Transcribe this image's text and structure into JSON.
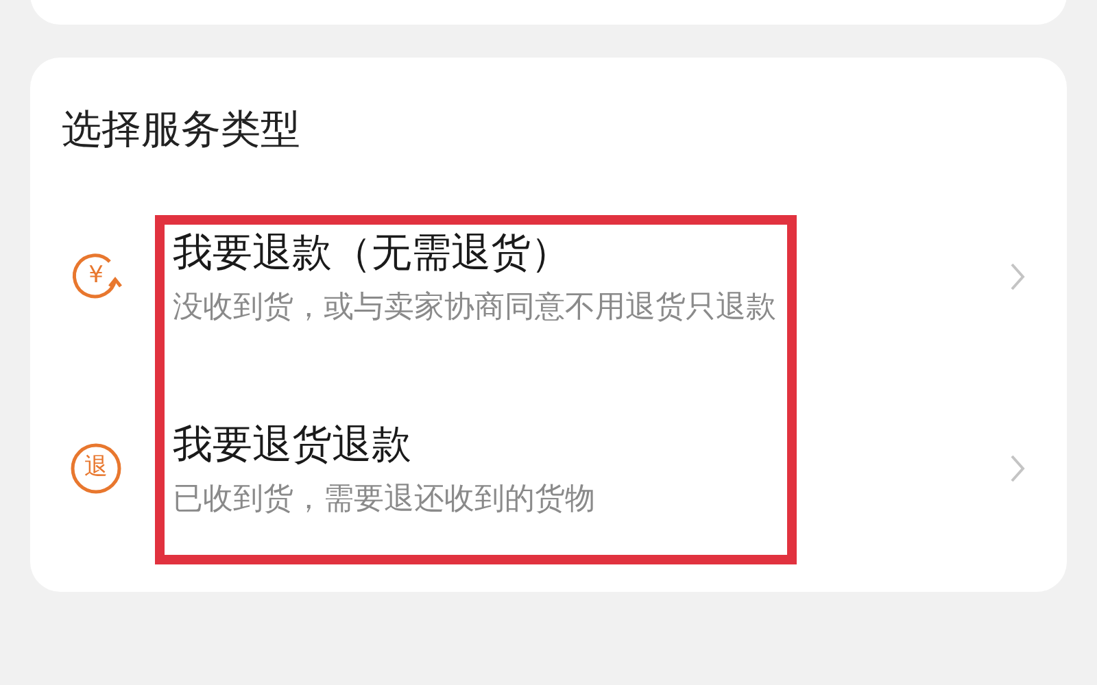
{
  "section_title": "选择服务类型",
  "options": [
    {
      "kind": "refund",
      "icon_text": "¥",
      "title": "我要退款（无需退货）",
      "subtitle": "没收到货，或与卖家协商同意不用退货只退款"
    },
    {
      "kind": "return",
      "icon_text": "退",
      "title": "我要退货退款",
      "subtitle": "已收到货，需要退还收到的货物"
    }
  ],
  "highlight": {
    "color": "#e1323f"
  }
}
